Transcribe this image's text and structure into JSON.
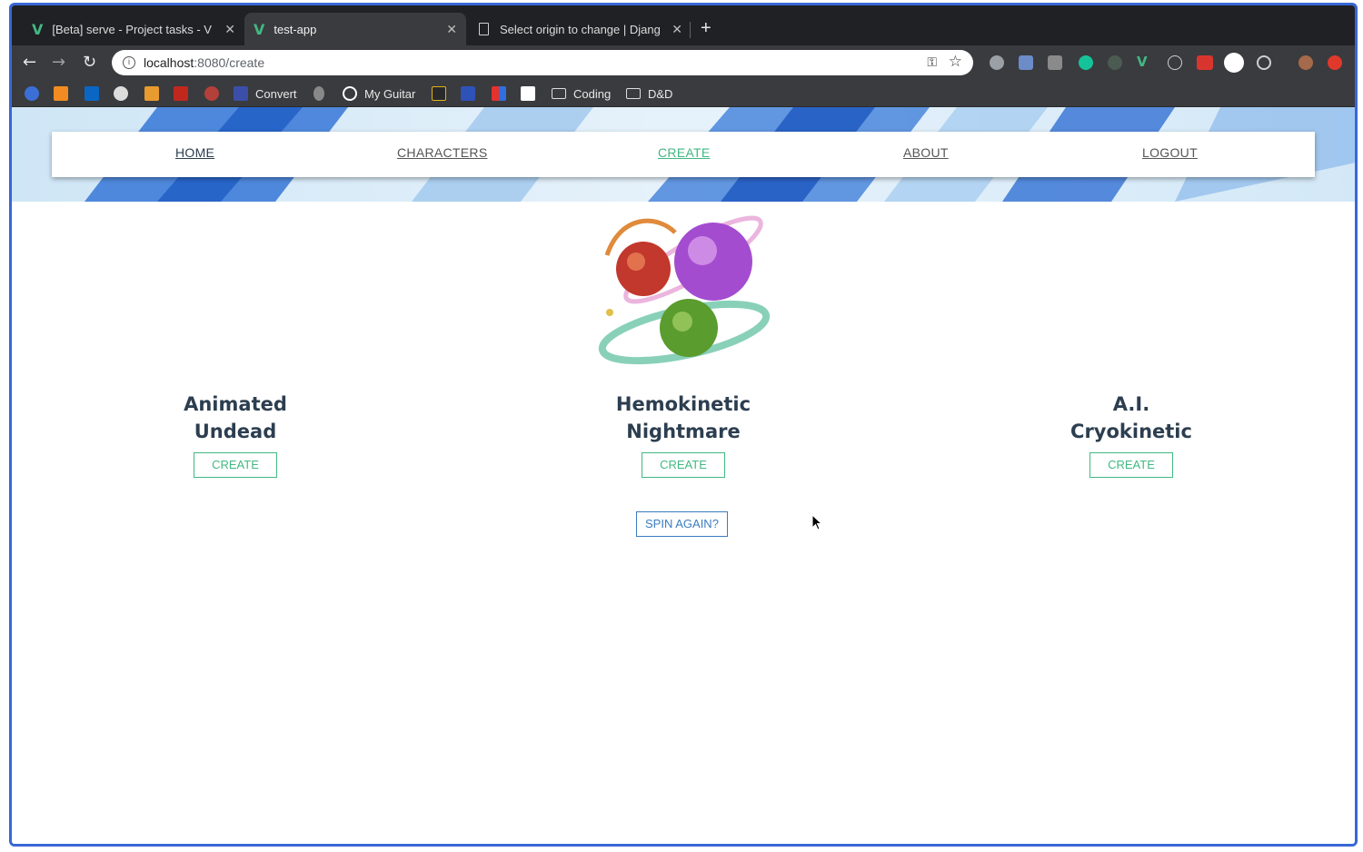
{
  "browser": {
    "tabs": [
      {
        "title": "[Beta] serve - Project tasks - V",
        "active": false
      },
      {
        "title": "test-app",
        "active": true
      },
      {
        "title": "Select origin to change | Djang",
        "active": false
      }
    ],
    "url_host": "localhost",
    "url_path": ":8080/create",
    "bookmarks": [
      {
        "label": "Convert"
      },
      {
        "label": "My Guitar"
      },
      {
        "label": "Coding"
      },
      {
        "label": "D&D"
      }
    ]
  },
  "nav": {
    "items": [
      "HOME",
      "CHARACTERS",
      "CREATE",
      "ABOUT",
      "LOGOUT"
    ],
    "active": "CREATE"
  },
  "options": [
    {
      "line1": "Animated",
      "line2": "Undead",
      "button": "CREATE"
    },
    {
      "line1": "Hemokinetic",
      "line2": "Nightmare",
      "button": "CREATE"
    },
    {
      "line1": "A.I.",
      "line2": "Cryokinetic",
      "button": "CREATE"
    }
  ],
  "spin_label": "SPIN AGAIN?",
  "colors": {
    "accent": "#42b883",
    "spin": "#3a7cc0",
    "heading": "#2c3e50",
    "frame": "#3867d6"
  }
}
